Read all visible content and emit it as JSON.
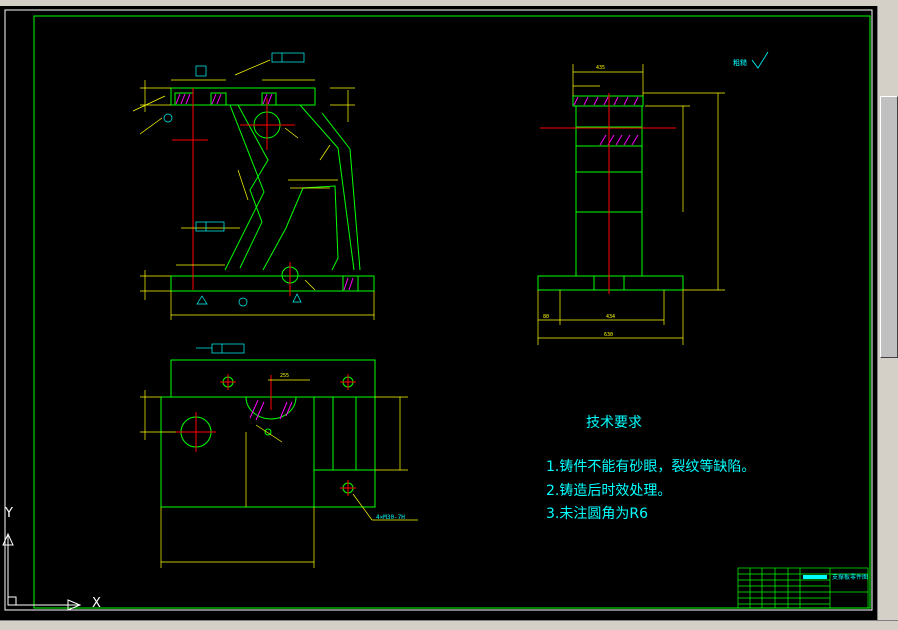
{
  "drawing": {
    "roughness_note": "粗糙",
    "hole_note": "4×M30-7H",
    "dimensions": [
      "435",
      "434",
      "630",
      "80",
      "255"
    ]
  },
  "tech_requirements": {
    "title": "技术要求",
    "items": [
      "1.铸件不能有砂眼，裂纹等缺陷。",
      "2.铸造后时效处理。",
      "3.未注圆角为R6"
    ]
  },
  "title_block": {
    "name": "支撑板零件图"
  },
  "ucs": {
    "y_label": "Y",
    "x_label": "X"
  },
  "colors": {
    "background": "#000000",
    "outline": "#00ff00",
    "center_line": "#ff0000",
    "dimension": "#ffff00",
    "text": "#00ffff",
    "hatch": "#ff00ff",
    "ucs": "#ffffff"
  }
}
